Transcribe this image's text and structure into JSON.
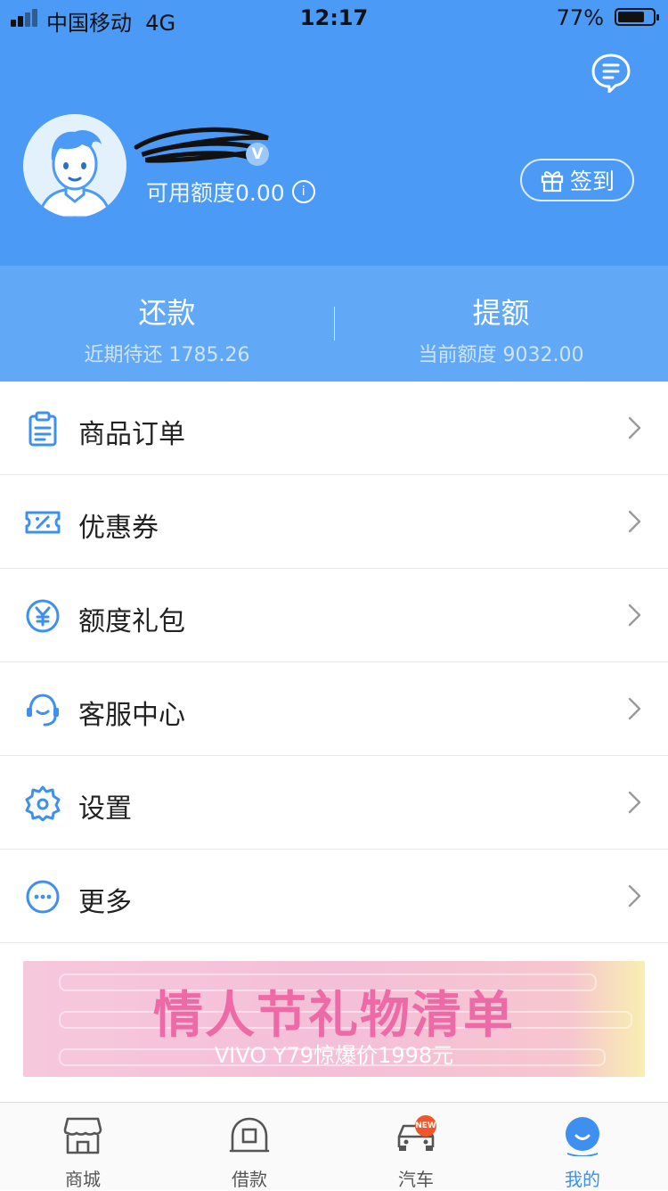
{
  "status_bar": {
    "carrier": "中国移动",
    "network": "4G",
    "time": "12:17",
    "battery": "77%",
    "battery_level": 0.77
  },
  "profile": {
    "credit_text": "可用额度0.00",
    "checkin_label": "签到",
    "verified_badge": "V"
  },
  "quick_actions": [
    {
      "title": "还款",
      "subtitle": "近期待还 1785.26"
    },
    {
      "title": "提额",
      "subtitle": "当前额度 9032.00"
    }
  ],
  "menu": [
    {
      "label": "商品订单",
      "icon": "clipboard-icon"
    },
    {
      "label": "优惠券",
      "icon": "coupon-icon"
    },
    {
      "label": "额度礼包",
      "icon": "yen-icon"
    },
    {
      "label": "客服中心",
      "icon": "headset-icon"
    },
    {
      "label": "设置",
      "icon": "gear-icon"
    },
    {
      "label": "更多",
      "icon": "more-icon"
    }
  ],
  "banner": {
    "headline": "情人节礼物清单",
    "subline": "VIVO Y79惊爆价1998元"
  },
  "tabs": [
    {
      "label": "商城",
      "icon": "store-icon"
    },
    {
      "label": "借款",
      "icon": "loan-icon"
    },
    {
      "label": "汽车",
      "icon": "car-icon",
      "badge": "NEW"
    },
    {
      "label": "我的",
      "icon": "profile-icon",
      "active": true
    }
  ],
  "colors": {
    "header_blue": "#4a9af6",
    "panel_blue": "#61a9f6",
    "icon_blue": "#3d90ef",
    "badge_orange": "#f0562a"
  }
}
